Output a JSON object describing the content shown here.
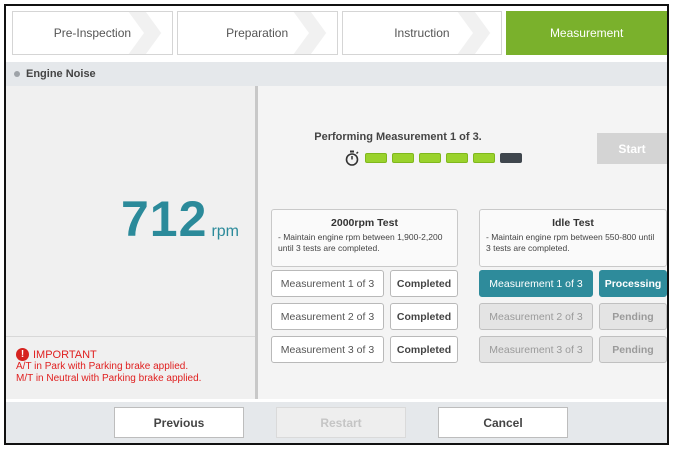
{
  "steps": [
    {
      "label": "Pre-Inspection"
    },
    {
      "label": "Preparation"
    },
    {
      "label": "Instruction"
    },
    {
      "label": "Measurement"
    }
  ],
  "section": {
    "title": "Engine Noise"
  },
  "readout": {
    "value": "712",
    "unit": "rpm"
  },
  "important": {
    "title": "IMPORTANT",
    "line1": "A/T in Park with Parking brake applied.",
    "line2": "M/T in Neutral with Parking brake applied."
  },
  "measurement": {
    "status": "Performing Measurement 1 of 3.",
    "progress_segments": 6,
    "progress_completed": 5,
    "start_label": "Start"
  },
  "tests": [
    {
      "title": "2000rpm Test",
      "desc": "- Maintain engine rpm between 1,900-2,200 until 3 tests are completed.",
      "rows": [
        {
          "label": "Measurement 1 of 3",
          "status": "Completed"
        },
        {
          "label": "Measurement 2 of 3",
          "status": "Completed"
        },
        {
          "label": "Measurement 3 of 3",
          "status": "Completed"
        }
      ]
    },
    {
      "title": "Idle Test",
      "desc": "- Maintain engine rpm between 550-800 until 3 tests are completed.",
      "rows": [
        {
          "label": "Measurement 1 of 3",
          "status": "Processing"
        },
        {
          "label": "Measurement 2 of 3",
          "status": "Pending"
        },
        {
          "label": "Measurement 3 of 3",
          "status": "Pending"
        }
      ]
    }
  ],
  "footer": {
    "previous": "Previous",
    "restart": "Restart",
    "cancel": "Cancel"
  },
  "colors": {
    "accent_green": "#7ab12c",
    "teal": "#2e8b9b",
    "warning_red": "#e02020"
  },
  "icons": {
    "timer": "stopwatch-icon",
    "warning": "exclamation-circle-icon"
  }
}
